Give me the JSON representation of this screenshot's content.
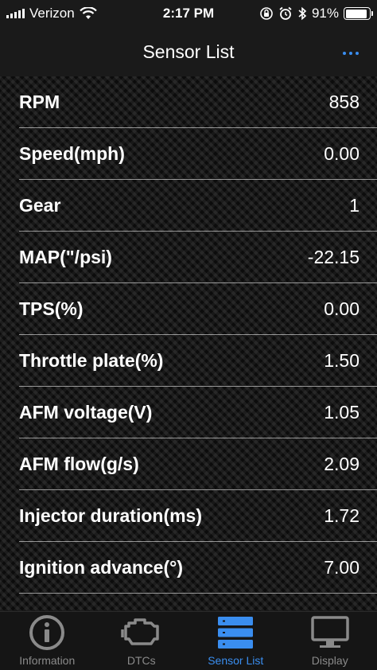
{
  "status_bar": {
    "carrier": "Verizon",
    "time": "2:17 PM",
    "battery_percent": "91%",
    "battery_level": 0.91,
    "icons": [
      "signal-icon",
      "wifi-icon",
      "orientation-lock-icon",
      "alarm-icon",
      "bluetooth-icon",
      "battery-icon"
    ]
  },
  "nav": {
    "title": "Sensor List",
    "more_icon": "ellipsis-icon"
  },
  "sensors": [
    {
      "label": "RPM",
      "value": "858"
    },
    {
      "label": "Speed(mph)",
      "value": "0.00"
    },
    {
      "label": "Gear",
      "value": "1"
    },
    {
      "label": "MAP(\"/psi)",
      "value": "-22.15"
    },
    {
      "label": "TPS(%)",
      "value": "0.00"
    },
    {
      "label": "Throttle plate(%)",
      "value": "1.50"
    },
    {
      "label": "AFM voltage(V)",
      "value": "1.05"
    },
    {
      "label": "AFM flow(g/s)",
      "value": "2.09"
    },
    {
      "label": "Injector duration(ms)",
      "value": "1.72"
    },
    {
      "label": "Ignition advance(°)",
      "value": "7.00"
    }
  ],
  "tabs": [
    {
      "label": "Information",
      "icon": "info-icon",
      "active": false
    },
    {
      "label": "DTCs",
      "icon": "engine-icon",
      "active": false
    },
    {
      "label": "Sensor List",
      "icon": "list-icon",
      "active": true
    },
    {
      "label": "Display",
      "icon": "monitor-icon",
      "active": false
    }
  ],
  "colors": {
    "accent": "#3a8ef0",
    "inactive_tab": "#8a8a8a",
    "bar_background": "#1a1a1a"
  }
}
